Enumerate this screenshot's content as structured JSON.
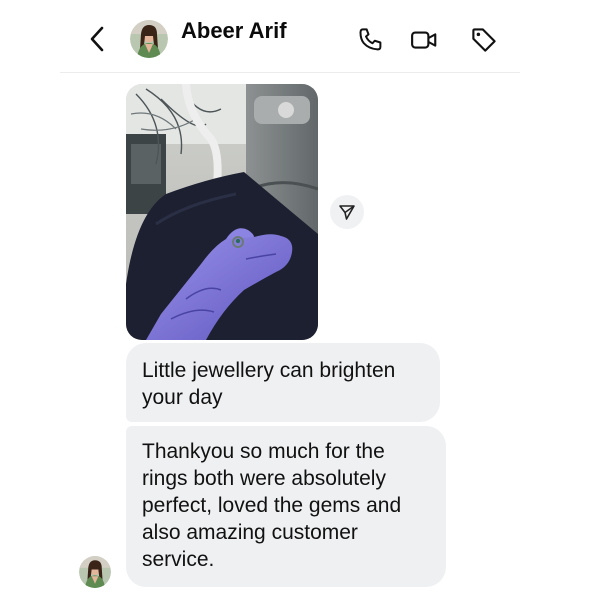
{
  "header": {
    "contact_name": "Abeer Arif",
    "back_icon": "chevron-left-icon",
    "actions": [
      "phone-icon",
      "video-camera-icon",
      "tag-icon"
    ]
  },
  "messages": [
    {
      "type": "image",
      "alt": "gloved-hand-with-ring"
    },
    {
      "type": "text",
      "text": "Little jewellery can brighten your day"
    },
    {
      "type": "text",
      "text": "Thankyou so much for the rings both were absolutely perfect, loved the gems and also amazing customer service."
    }
  ],
  "colors": {
    "bubble_background": "#eff0f2",
    "glove": "#7d74d8",
    "text": "#111111"
  }
}
